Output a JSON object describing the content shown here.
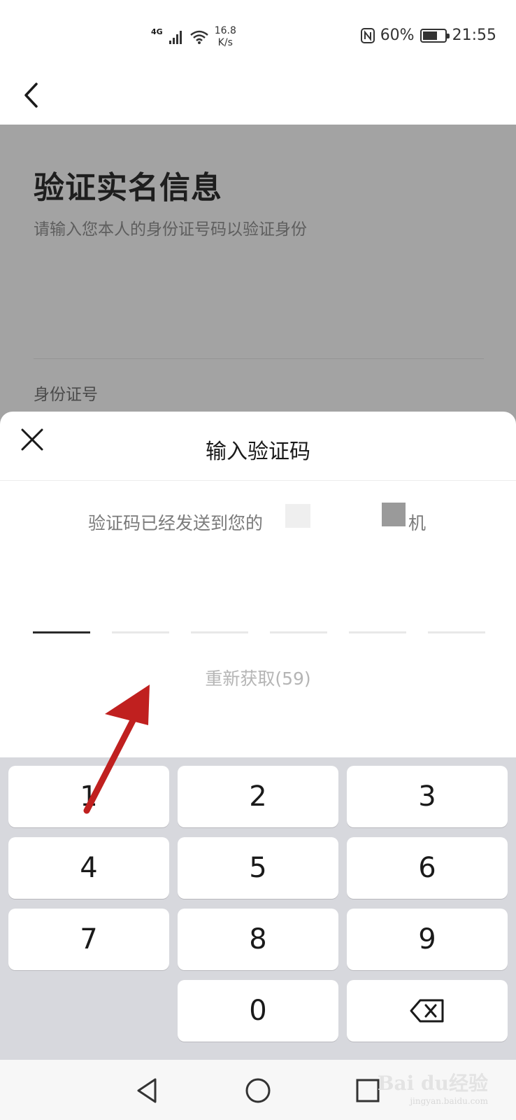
{
  "status_bar": {
    "network": "4G",
    "speed_value": "16.8",
    "speed_unit": "K/s",
    "battery": "60%",
    "battery_level": 0.6,
    "time": "21:55"
  },
  "page": {
    "title": "验证实名信息",
    "subtitle": "请输入您本人的身份证号码以验证身份",
    "id_label": "身份证号"
  },
  "sheet": {
    "title": "输入验证码",
    "sent_text": "验证码已经发送到您的",
    "sent_tail": "机",
    "code_length": 6,
    "active_slot": 0,
    "resend_label": "重新获取(59)"
  },
  "keypad": {
    "keys": [
      "1",
      "2",
      "3",
      "4",
      "5",
      "6",
      "7",
      "8",
      "9",
      "",
      "0",
      "⌫"
    ]
  },
  "navbar": {
    "buttons": [
      "back-triangle",
      "home-circle",
      "recents-square"
    ]
  },
  "watermark": {
    "text": "Bai du经验",
    "sub": "jingyan.baidu.com"
  },
  "colors": {
    "dim_overlay": "#a3a3a3",
    "keypad_bg": "#d7d8dd",
    "annotation_arrow": "#c0201f"
  }
}
